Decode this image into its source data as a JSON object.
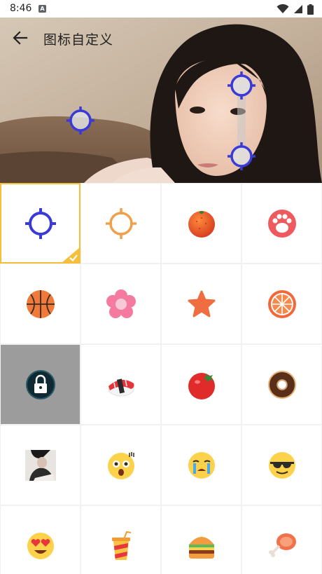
{
  "status_bar": {
    "time": "8:46",
    "notification_icon": "A",
    "icons": [
      "wifi-icon",
      "signal-icon",
      "battery-icon"
    ]
  },
  "header": {
    "title": "图标自定义",
    "back_icon": "arrow-left-icon",
    "accent": "#3a3ad6"
  },
  "grid": {
    "selected_index": 0,
    "selected_color": "#f5bf3b",
    "items": [
      {
        "name": "crosshair-blue-icon"
      },
      {
        "name": "crosshair-orange-icon"
      },
      {
        "name": "orange-ball-icon"
      },
      {
        "name": "paw-icon"
      },
      {
        "name": "basketball-icon"
      },
      {
        "name": "flower-icon"
      },
      {
        "name": "star-icon"
      },
      {
        "name": "orange-slice-icon"
      },
      {
        "name": "lock-icon"
      },
      {
        "name": "sushi-icon"
      },
      {
        "name": "tomato-icon"
      },
      {
        "name": "donut-icon"
      },
      {
        "name": "photo-thumbnail-icon"
      },
      {
        "name": "shocked-emoji-icon"
      },
      {
        "name": "crying-emoji-icon"
      },
      {
        "name": "sunglasses-emoji-icon"
      },
      {
        "name": "heart-eyes-emoji-icon"
      },
      {
        "name": "drink-cup-icon"
      },
      {
        "name": "burger-icon"
      },
      {
        "name": "drumstick-icon"
      }
    ]
  }
}
